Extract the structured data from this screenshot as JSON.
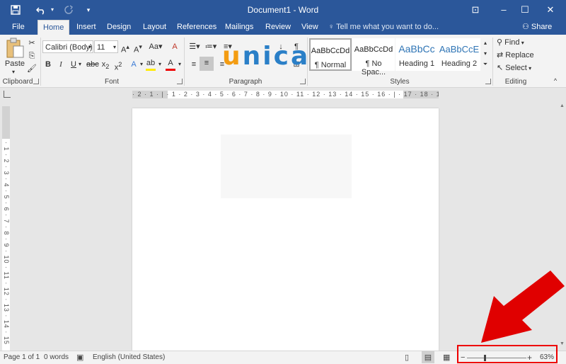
{
  "titlebar": {
    "title": "Document1 - Word",
    "save_icon": "save-icon",
    "undo_icon": "undo-icon",
    "redo_icon": "redo-icon",
    "minimize": "–",
    "restore": "☐",
    "close": "✕",
    "ribbon_display": "⊡"
  },
  "tabs": [
    "File",
    "Home",
    "Insert",
    "Design",
    "Layout",
    "References",
    "Mailings",
    "Review",
    "View"
  ],
  "tellme": "Tell me what you want to do...",
  "share": "Share",
  "ribbon": {
    "clipboard": {
      "label": "Clipboard",
      "paste": "Paste"
    },
    "font": {
      "label": "Font",
      "family": "Calibri (Body)",
      "size": "11"
    },
    "paragraph": {
      "label": "Paragraph"
    },
    "styles": {
      "label": "Styles",
      "items": [
        {
          "sample": "AaBbCcDd",
          "name": "¶ Normal"
        },
        {
          "sample": "AaBbCcDd",
          "name": "¶ No Spac..."
        },
        {
          "sample": "AaBbCc",
          "name": "Heading 1"
        },
        {
          "sample": "AaBbCcE",
          "name": "Heading 2"
        }
      ]
    },
    "editing": {
      "label": "Editing",
      "find": "Find",
      "replace": "Replace",
      "select": "Select"
    }
  },
  "logo": {
    "u": "u",
    "nica": "nica"
  },
  "ruler": {
    "horizontal": "· 2 · 1 · | · 1 · 2 · 3 · 4 · 5 · 6 · 7 · 8 · 9 · 10 · 11 · 12 · 13 · 14 · 15 · 16 · | · 17 · 18 · 19",
    "vertical": "· 1 · 2 · 3 · 4 · 5 · 6 · 7 · 8 · 9 · 10 · 11 · 12 · 13 · 14 · 15"
  },
  "statusbar": {
    "page": "Page 1 of 1",
    "words": "0 words",
    "language": "English (United States)",
    "zoom": "63%",
    "zoom_level": 0.63
  },
  "colors": {
    "brand": "#2b579a",
    "highlight": "#e00000",
    "logo_orange": "#f39c12",
    "logo_blue": "#2a7fc7"
  }
}
